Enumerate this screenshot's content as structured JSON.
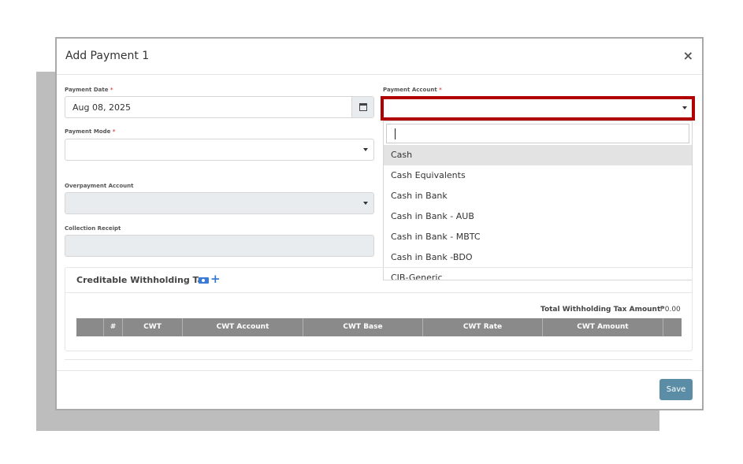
{
  "modal": {
    "title": "Add Payment 1",
    "close_glyph": "×"
  },
  "fields": {
    "payment_date": {
      "label": "Payment Date",
      "required_mark": "*",
      "value": "Aug 08, 2025"
    },
    "payment_account": {
      "label": "Payment Account",
      "required_mark": "*",
      "value": ""
    },
    "payment_mode": {
      "label": "Payment Mode",
      "required_mark": "*",
      "value": ""
    },
    "overpayment_account": {
      "label": "Overpayment Account",
      "value": ""
    },
    "collection_receipt": {
      "label": "Collection Receipt",
      "value": ""
    }
  },
  "dropdown": {
    "search_value": "",
    "items": [
      "Cash",
      "Cash Equivalents",
      "Cash in Bank",
      "Cash in Bank - AUB",
      "Cash in Bank - MBTC",
      "Cash in Bank -BDO",
      "CIB-Generic"
    ],
    "active_index": 0
  },
  "cwt": {
    "title": "Creditable Withholding Tax",
    "total_label": "Total Withholding Tax Amount",
    "total_value": "₱0.00",
    "columns": [
      "",
      "#",
      "CWT",
      "CWT Account",
      "CWT Base",
      "CWT Rate",
      "CWT Amount",
      ""
    ]
  },
  "footer": {
    "save_label": "Save"
  },
  "icons": {
    "calendar": "calendar-icon",
    "money": "money-icon",
    "plus": "plus-icon",
    "close": "close-icon"
  },
  "colors": {
    "highlight": "#b00000",
    "save": "#5b8ea6",
    "table_header": "#8a8a8a",
    "accent": "#3a7bd5"
  }
}
